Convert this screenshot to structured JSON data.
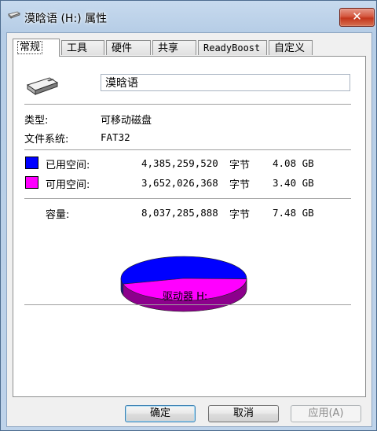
{
  "window": {
    "title": "漠晗语 (H:) 属性",
    "close_symbol": "✕"
  },
  "tabs": [
    {
      "label": "常规"
    },
    {
      "label": "工具"
    },
    {
      "label": "硬件"
    },
    {
      "label": "共享"
    },
    {
      "label": "ReadyBoost"
    },
    {
      "label": "自定义"
    }
  ],
  "general": {
    "drive_name": "漠晗语",
    "type_label": "类型:",
    "type_value": "可移动磁盘",
    "fs_label": "文件系统:",
    "fs_value": "FAT32",
    "used": {
      "label": "已用空间:",
      "bytes": "4,385,259,520",
      "unit": "字节",
      "size": "4.08 GB",
      "color": "#0000ff"
    },
    "free": {
      "label": "可用空间:",
      "bytes": "3,652,026,368",
      "unit": "字节",
      "size": "3.40 GB",
      "color": "#ff00ff"
    },
    "capacity": {
      "label": "容量:",
      "bytes": "8,037,285,888",
      "unit": "字节",
      "size": "7.48 GB"
    },
    "drive_label": "驱动器 H:"
  },
  "usage_pie": {
    "used_fraction": 0.5456,
    "free_fraction": 0.4544
  },
  "buttons": {
    "ok": "确定",
    "cancel": "取消",
    "apply": "应用(A)"
  }
}
